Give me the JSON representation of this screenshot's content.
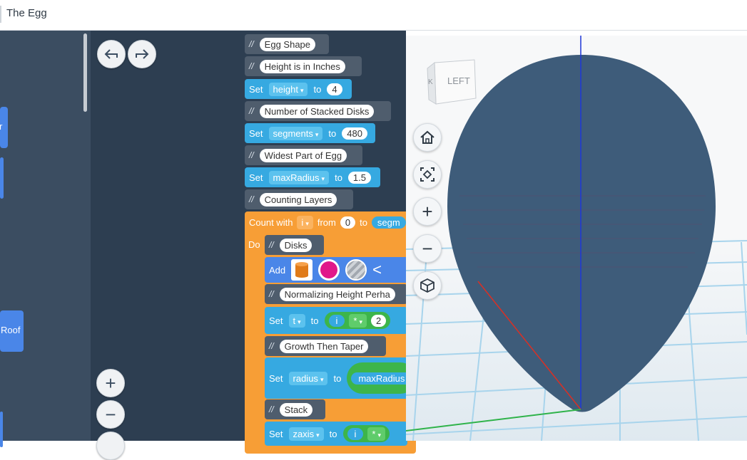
{
  "window": {
    "title": "The Egg"
  },
  "toolbox": {
    "items": [
      {
        "label": "r"
      },
      {
        "label": ""
      },
      {
        "label": "Roof"
      },
      {
        "label": ""
      }
    ]
  },
  "workspace_controls": {
    "undo": "undo-icon",
    "redo": "redo-icon",
    "zoom_in": "+",
    "zoom_out": "−"
  },
  "code": {
    "comment_mark": "//",
    "set_keyword": "Set",
    "to_keyword": "to",
    "lines": {
      "c1": "Egg Shape",
      "c2": "Height is in Inches",
      "s1_var": "height",
      "s1_val": "4",
      "c3": "Number of Stacked Disks",
      "s2_var": "segments",
      "s2_val": "480",
      "c4": "Widest Part of Egg",
      "s3_var": "maxRadius",
      "s3_val": "1.5",
      "c5": "Counting Layers"
    },
    "loop": {
      "count_with": "Count with",
      "var": "i",
      "from": "from",
      "from_val": "0",
      "to": "to",
      "to_var": "segm",
      "do": "Do",
      "c_disks": "Disks",
      "add": "Add",
      "c_norm": "Normalizing Height Perha",
      "set_t_var": "t",
      "t_expr_var": "i",
      "t_op": "*",
      "t_num": "2",
      "c_growth": "Growth Then Taper",
      "set_radius_var": "radius",
      "radius_expr": "maxRadius",
      "c_stack": "Stack",
      "set_zaxis_var": "zaxis",
      "zaxis_expr_var": "i",
      "zaxis_op": "*"
    }
  },
  "viewport": {
    "view_cube_label": "LEFT",
    "view_cube_side": "K",
    "buttons": [
      "home-icon",
      "fit-view-icon",
      "zoom-in-icon",
      "zoom-out-icon",
      "perspective-icon"
    ],
    "zoom_in_label": "+",
    "zoom_out_label": "−",
    "colors": {
      "egg": "#3e5c7a",
      "grid": "#a8d4ec",
      "z_axis": "#1f36d8",
      "x_axis": "#d93025",
      "y_axis": "#2fb34a"
    }
  }
}
